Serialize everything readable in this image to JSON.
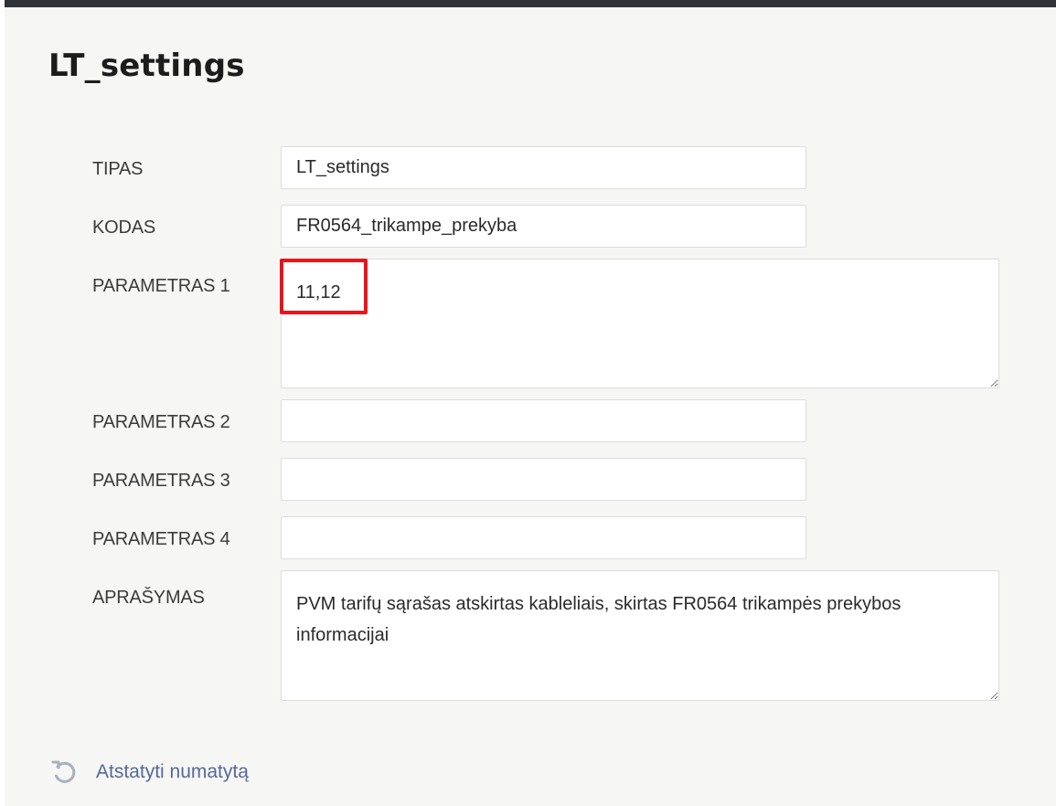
{
  "page": {
    "title": "LT_settings"
  },
  "form": {
    "fields": [
      {
        "label": "TIPAS",
        "value": "LT_settings"
      },
      {
        "label": "KODAS",
        "value": "FR0564_trikampe_prekyba"
      },
      {
        "label": "PARAMETRAS 1",
        "value": "11,12"
      },
      {
        "label": "PARAMETRAS 2",
        "value": ""
      },
      {
        "label": "PARAMETRAS 3",
        "value": ""
      },
      {
        "label": "PARAMETRAS 4",
        "value": ""
      },
      {
        "label": "APRAŠYMAS",
        "value": "PVM tarifų sąrašas atskirtas kableliais, skirtas FR0564 trikampės prekybos informacijai"
      }
    ]
  },
  "actions": {
    "reset_label": "Atstatyti numatytą",
    "reset_icon": "undo-icon"
  },
  "colors": {
    "highlight": "#e8151b",
    "link": "#55699a",
    "top_bar": "#2f3236",
    "background": "#f6f6f4"
  }
}
